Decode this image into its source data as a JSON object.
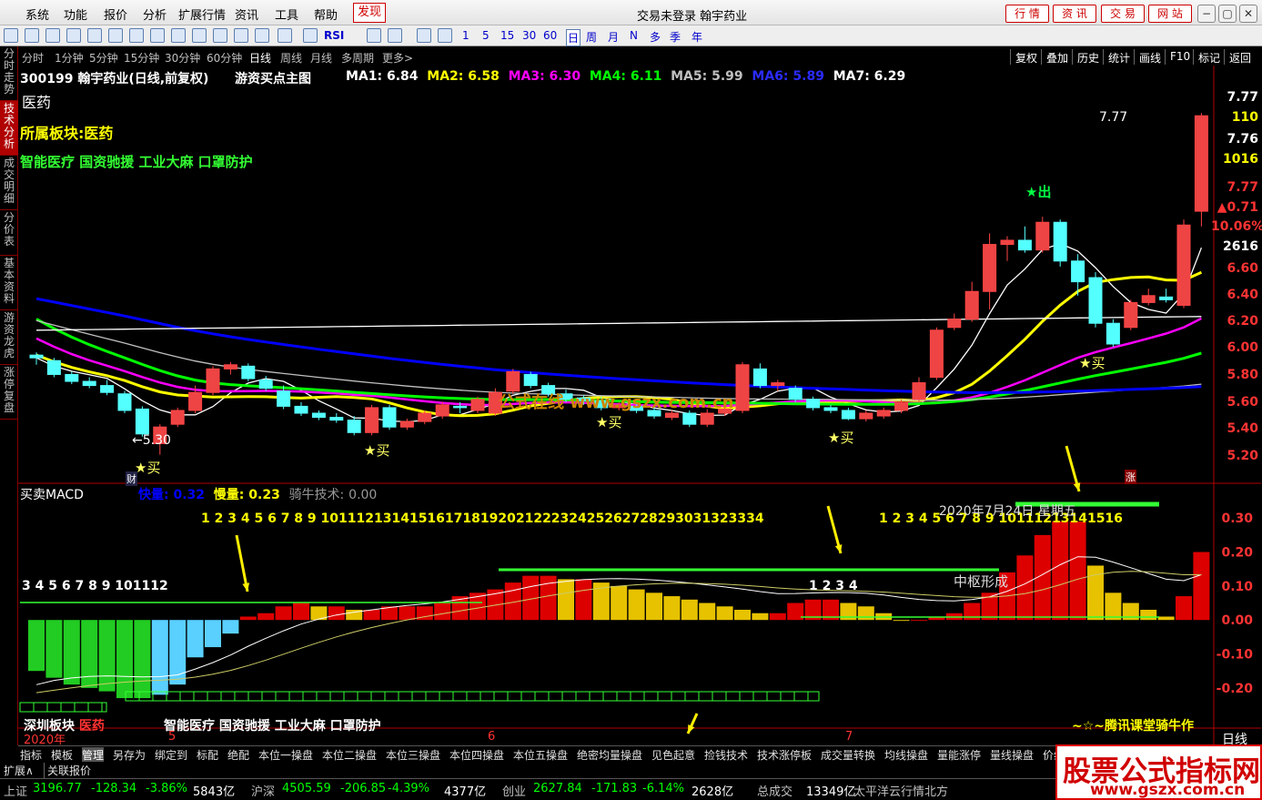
{
  "menubar": {
    "items": [
      "系统",
      "功能",
      "报价",
      "分析",
      "扩展行情",
      "资讯",
      "工具",
      "帮助",
      "发现"
    ],
    "active": "发现",
    "title": "交易未登录  翰宇药业",
    "right_buttons": [
      "行 情",
      "资 讯",
      "交 易",
      "网 站"
    ],
    "window_buttons": [
      "−",
      "▢",
      "✕"
    ]
  },
  "toolbar": {
    "periods": [
      "1",
      "5",
      "15",
      "30",
      "60"
    ],
    "ranges": [
      "日",
      "周",
      "月",
      "N",
      "多",
      "季",
      "年"
    ],
    "rsi_label": "RSI"
  },
  "leftbar": {
    "tabs": [
      "分时走势",
      "技术分析",
      "成交明细",
      "分价表",
      "基本资料",
      "游资龙虎",
      "涨停复盘"
    ],
    "active": "技术分析"
  },
  "periodbar": {
    "items": [
      "分时",
      "1分钟",
      "5分钟",
      "15分钟",
      "30分钟",
      "60分钟",
      "日线",
      "周线",
      "月线",
      "多周期",
      "更多>"
    ],
    "active": "日线",
    "right_items": [
      "复权",
      "叠加",
      "历史",
      "统计",
      "画线",
      "F10",
      "标记",
      "返回"
    ]
  },
  "main_header": {
    "stock": "300199 翰宇药业(日线,前复权)",
    "indicator": "游资买点主图",
    "ma": [
      {
        "label": "MA1:",
        "value": "6.84",
        "color": "#ffffff"
      },
      {
        "label": "MA2:",
        "value": "6.58",
        "color": "#ffff00"
      },
      {
        "label": "MA3:",
        "value": "6.30",
        "color": "#ff00ff"
      },
      {
        "label": "MA4:",
        "value": "6.11",
        "color": "#00ff00"
      },
      {
        "label": "MA5:",
        "value": "5.99",
        "color": "#c0c0c0"
      },
      {
        "label": "MA6:",
        "value": "5.89",
        "color": "#0000ff"
      },
      {
        "label": "MA7:",
        "value": "6.29",
        "color": "#ffffff"
      }
    ],
    "sector": "医药",
    "board_label": "所属板块:医药",
    "concepts": "智能医疗 国资驰援 工业大麻 口罩防护",
    "watermark": "公式在线 www.gszx.com.cn",
    "high_label": "7.77",
    "low_label": "←5.30",
    "out_label": "出",
    "buy_label": "买",
    "fin_label": "财",
    "zhang_label": "涨"
  },
  "price_scale": [
    {
      "text": "7.77",
      "color": "#ffffff"
    },
    {
      "text": "110",
      "color": "#ffff00"
    },
    {
      "text": "7.76",
      "color": "#ffffff"
    },
    {
      "text": "1016",
      "color": "#ffff00"
    },
    {
      "text": "7.77",
      "color": "#ff3333"
    },
    {
      "text": "▲0.71",
      "color": "#ff3333"
    },
    {
      "text": "10.06%",
      "color": "#ff3333"
    },
    {
      "text": "2616",
      "color": "#ffffff"
    },
    {
      "text": "6.60",
      "color": "#ff3333"
    },
    {
      "text": "6.40",
      "color": "#ff3333"
    },
    {
      "text": "6.20",
      "color": "#ff3333"
    },
    {
      "text": "6.00",
      "color": "#ff3333"
    },
    {
      "text": "5.80",
      "color": "#ff3333"
    },
    {
      "text": "5.60",
      "color": "#ff3333"
    },
    {
      "text": "5.40",
      "color": "#ff3333"
    },
    {
      "text": "5.20",
      "color": "#ff3333"
    }
  ],
  "macd_header": {
    "title": "买卖MACD",
    "fast_label": "快量:",
    "fast_value": "0.32",
    "slow_label": "慢量:",
    "slow_value": "0.23",
    "tech_label": "骑牛技术:",
    "tech_value": "0.00"
  },
  "macd_scale": [
    "0.30",
    "0.20",
    "0.10",
    "0.00",
    "-0.10",
    "-0.20"
  ],
  "macd_overlay": {
    "count_a": "3 4 5 6 7 8 9 101112",
    "count_b": "1 2 3 4 5 6 7 8 9 10111213141516171819202122232425262728293031323334",
    "count_c": "1 2 3 4",
    "count_d": "1 2 3 4 5 6 7 8 9 10111213141516",
    "date_label": "2020年7月24日 星期五",
    "center_label": "中枢形成",
    "sector_label": "深圳板块",
    "sector_value": "医药",
    "concepts": "智能医疗 国资驰援 工业大麻 口罩防护",
    "credit": "~☆~腾讯课堂骑牛作",
    "year_label": "2020年",
    "month_labels": [
      "5",
      "6",
      "7"
    ],
    "period_label": "日线"
  },
  "bottom_tabs": [
    "指标",
    "模板",
    "管理",
    "另存为",
    "绑定到",
    "标配",
    "绝配",
    "本位一操盘",
    "本位二操盘",
    "本位三操盘",
    "本位四操盘",
    "本位五操盘",
    "绝密均量操盘",
    "见色起意",
    "捡钱技术",
    "技术涨停板",
    "成交量转换",
    "均线操盘",
    "量能涨停",
    "量线操盘",
    "价线双过"
  ],
  "bottom_active": "管理",
  "footer_tabs": [
    "扩展∧",
    "关联报价"
  ],
  "status": [
    {
      "text": "上证",
      "color": "#c0c0c0"
    },
    {
      "text": "3196.77",
      "color": "#00ff00"
    },
    {
      "text": "-128.34",
      "color": "#00ff00"
    },
    {
      "text": "-3.86%",
      "color": "#00ff00"
    },
    {
      "text": "5843亿",
      "color": "#ffffff"
    },
    {
      "text": "沪深",
      "color": "#c0c0c0"
    },
    {
      "text": "4505.59",
      "color": "#00ff00"
    },
    {
      "text": "-206.85",
      "color": "#00ff00"
    },
    {
      "text": "-4.39%",
      "color": "#00ff00"
    },
    {
      "text": "4377亿",
      "color": "#ffffff"
    },
    {
      "text": "创业",
      "color": "#c0c0c0"
    },
    {
      "text": "2627.84",
      "color": "#00ff00"
    },
    {
      "text": "-171.83",
      "color": "#00ff00"
    },
    {
      "text": "-6.14%",
      "color": "#00ff00"
    },
    {
      "text": "2628亿",
      "color": "#ffffff"
    },
    {
      "text": "总成交",
      "color": "#c0c0c0"
    },
    {
      "text": "13349亿",
      "color": "#ffffff"
    },
    {
      "text": "太平洋云行情北方",
      "color": "#c0c0c0"
    }
  ],
  "logo": {
    "text": "股票公式指标网",
    "url_text": "www.gszx.com.cn",
    "color": "#d00000"
  },
  "chart_data": {
    "type": "candlestick",
    "title": "300199 翰宇药业(日线,前复权)",
    "ylim": [
      5.1,
      7.85
    ],
    "candles": [
      [
        6.02,
        6.0,
        5.95,
        6.04
      ],
      [
        5.98,
        5.88,
        5.86,
        6.0
      ],
      [
        5.88,
        5.83,
        5.81,
        5.9
      ],
      [
        5.83,
        5.8,
        5.78,
        5.86
      ],
      [
        5.8,
        5.75,
        5.73,
        5.84
      ],
      [
        5.74,
        5.62,
        5.6,
        5.76
      ],
      [
        5.63,
        5.45,
        5.43,
        5.65
      ],
      [
        5.38,
        5.5,
        5.3,
        5.52
      ],
      [
        5.52,
        5.62,
        5.5,
        5.64
      ],
      [
        5.62,
        5.75,
        5.6,
        5.8
      ],
      [
        5.75,
        5.92,
        5.73,
        5.94
      ],
      [
        5.92,
        5.95,
        5.88,
        5.97
      ],
      [
        5.94,
        5.85,
        5.83,
        5.96
      ],
      [
        5.84,
        5.78,
        5.76,
        5.87
      ],
      [
        5.76,
        5.65,
        5.63,
        5.8
      ],
      [
        5.65,
        5.6,
        5.58,
        5.68
      ],
      [
        5.6,
        5.57,
        5.55,
        5.62
      ],
      [
        5.57,
        5.55,
        5.53,
        5.6
      ],
      [
        5.55,
        5.46,
        5.44,
        5.58
      ],
      [
        5.46,
        5.64,
        5.44,
        5.66
      ],
      [
        5.64,
        5.5,
        5.48,
        5.66
      ],
      [
        5.5,
        5.54,
        5.48,
        5.56
      ],
      [
        5.54,
        5.6,
        5.52,
        5.62
      ],
      [
        5.58,
        5.66,
        5.56,
        5.68
      ],
      [
        5.65,
        5.64,
        5.6,
        5.68
      ],
      [
        5.62,
        5.7,
        5.6,
        5.72
      ],
      [
        5.6,
        5.75,
        5.58,
        5.78
      ],
      [
        5.76,
        5.9,
        5.74,
        5.92
      ],
      [
        5.88,
        5.8,
        5.78,
        5.9
      ],
      [
        5.8,
        5.74,
        5.72,
        5.82
      ],
      [
        5.74,
        5.7,
        5.68,
        5.77
      ],
      [
        5.71,
        5.69,
        5.66,
        5.73
      ],
      [
        5.69,
        5.64,
        5.62,
        5.72
      ],
      [
        5.64,
        5.66,
        5.62,
        5.68
      ],
      [
        5.65,
        5.62,
        5.6,
        5.67
      ],
      [
        5.62,
        5.58,
        5.56,
        5.64
      ],
      [
        5.57,
        5.6,
        5.55,
        5.62
      ],
      [
        5.6,
        5.52,
        5.5,
        5.62
      ],
      [
        5.52,
        5.6,
        5.5,
        5.63
      ],
      [
        5.6,
        5.63,
        5.58,
        5.66
      ],
      [
        5.62,
        5.95,
        5.6,
        5.97
      ],
      [
        5.92,
        5.8,
        5.78,
        5.96
      ],
      [
        5.8,
        5.82,
        5.76,
        5.84
      ],
      [
        5.78,
        5.7,
        5.68,
        5.8
      ],
      [
        5.7,
        5.64,
        5.62,
        5.72
      ],
      [
        5.64,
        5.62,
        5.6,
        5.66
      ],
      [
        5.62,
        5.56,
        5.55,
        5.64
      ],
      [
        5.56,
        5.6,
        5.54,
        5.62
      ],
      [
        5.58,
        5.62,
        5.56,
        5.64
      ],
      [
        5.62,
        5.68,
        5.6,
        5.7
      ],
      [
        5.7,
        5.82,
        5.68,
        5.86
      ],
      [
        5.86,
        6.2,
        5.84,
        6.22
      ],
      [
        6.22,
        6.28,
        6.2,
        6.32
      ],
      [
        6.28,
        6.48,
        6.26,
        6.55
      ],
      [
        6.48,
        6.82,
        6.35,
        6.9
      ],
      [
        6.82,
        6.85,
        6.7,
        6.88
      ],
      [
        6.85,
        6.78,
        6.76,
        6.95
      ],
      [
        6.78,
        6.98,
        6.76,
        7.02
      ],
      [
        6.98,
        6.7,
        6.66,
        7.0
      ],
      [
        6.7,
        6.55,
        6.45,
        6.75
      ],
      [
        6.58,
        6.25,
        6.22,
        6.62
      ],
      [
        6.25,
        6.1,
        6.08,
        6.28
      ],
      [
        6.22,
        6.4,
        6.2,
        6.42
      ],
      [
        6.4,
        6.45,
        6.38,
        6.5
      ],
      [
        6.44,
        6.42,
        6.4,
        6.5
      ],
      [
        6.38,
        6.96,
        6.36,
        7.0
      ],
      [
        7.06,
        7.75,
        6.95,
        7.77
      ]
    ],
    "buy_points": [
      7,
      19,
      33,
      46,
      60
    ],
    "sell_points": [
      57
    ],
    "ma_series": [
      {
        "name": "MA1",
        "color": "#ffffff"
      },
      {
        "name": "MA2",
        "color": "#ffff00"
      },
      {
        "name": "MA3",
        "color": "#ff00ff"
      },
      {
        "name": "MA4",
        "color": "#00ff00"
      },
      {
        "name": "MA5",
        "color": "#c0c0c0"
      },
      {
        "name": "MA6",
        "color": "#0000ff"
      },
      {
        "name": "MA7",
        "color": "#ffffff"
      }
    ],
    "macd_ylim": [
      -0.27,
      0.33
    ],
    "macd_bars": [
      -0.15,
      -0.17,
      -0.19,
      -0.2,
      -0.21,
      -0.23,
      -0.23,
      -0.22,
      -0.19,
      -0.11,
      -0.08,
      -0.04,
      0.01,
      0.02,
      0.04,
      0.05,
      0.04,
      0.04,
      0.03,
      0.03,
      0.04,
      0.04,
      0.04,
      0.05,
      0.07,
      0.08,
      0.09,
      0.11,
      0.13,
      0.13,
      0.12,
      0.12,
      0.11,
      0.1,
      0.09,
      0.08,
      0.07,
      0.06,
      0.05,
      0.04,
      0.03,
      0.02,
      0.02,
      0.05,
      0.06,
      0.06,
      0.05,
      0.04,
      0.02,
      0.0,
      0.0,
      0.01,
      0.02,
      0.05,
      0.08,
      0.14,
      0.19,
      0.25,
      0.29,
      0.29,
      0.16,
      0.08,
      0.05,
      0.03,
      0.01,
      0.07,
      0.2
    ],
    "macd_colors": "auto"
  }
}
